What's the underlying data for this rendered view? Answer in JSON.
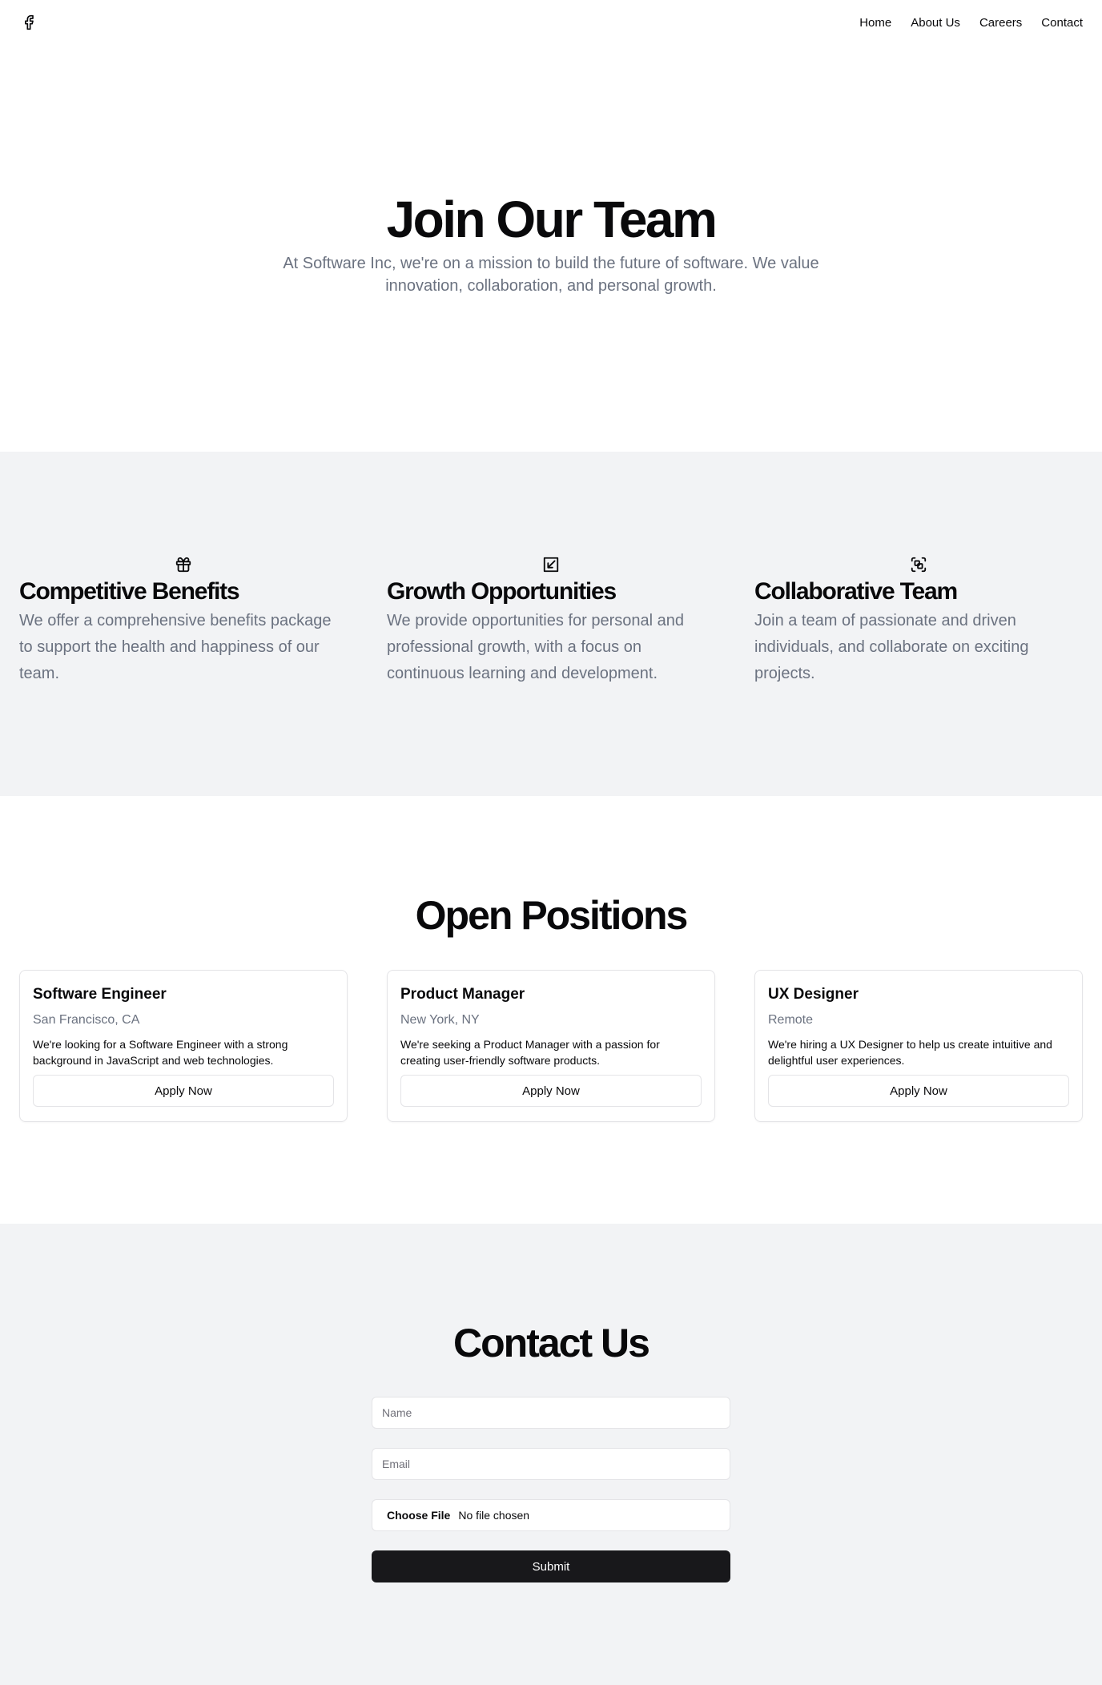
{
  "header": {
    "logo_icon": "facebook-icon",
    "nav": [
      "Home",
      "About Us",
      "Careers",
      "Contact"
    ]
  },
  "hero": {
    "title": "Join Our Team",
    "subtitle": "At Software Inc, we're on a mission to build the future of software. We value innovation, collaboration, and personal growth."
  },
  "features": [
    {
      "icon": "gift-icon",
      "title": "Competitive Benefits",
      "text": "We offer a comprehensive benefits package to support the health and happiness of our team."
    },
    {
      "icon": "growth-icon",
      "title": "Growth Opportunities",
      "text": "We provide opportunities for personal and professional growth, with a focus on continuous learning and development."
    },
    {
      "icon": "team-icon",
      "title": "Collaborative Team",
      "text": "Join a team of passionate and driven individuals, and collaborate on exciting projects."
    }
  ],
  "positions": {
    "title": "Open Positions",
    "items": [
      {
        "title": "Software Engineer",
        "location": "San Francisco, CA",
        "description": "We're looking for a Software Engineer with a strong background in JavaScript and web technologies.",
        "button": "Apply Now"
      },
      {
        "title": "Product Manager",
        "location": "New York, NY",
        "description": "We're seeking a Product Manager with a passion for creating user-friendly software products.",
        "button": "Apply Now"
      },
      {
        "title": "UX Designer",
        "location": "Remote",
        "description": "We're hiring a UX Designer to help us create intuitive and delightful user experiences.",
        "button": "Apply Now"
      }
    ]
  },
  "contact": {
    "title": "Contact Us",
    "name_placeholder": "Name",
    "email_placeholder": "Email",
    "file_button": "Choose File",
    "file_status": "No file chosen",
    "submit": "Submit"
  }
}
